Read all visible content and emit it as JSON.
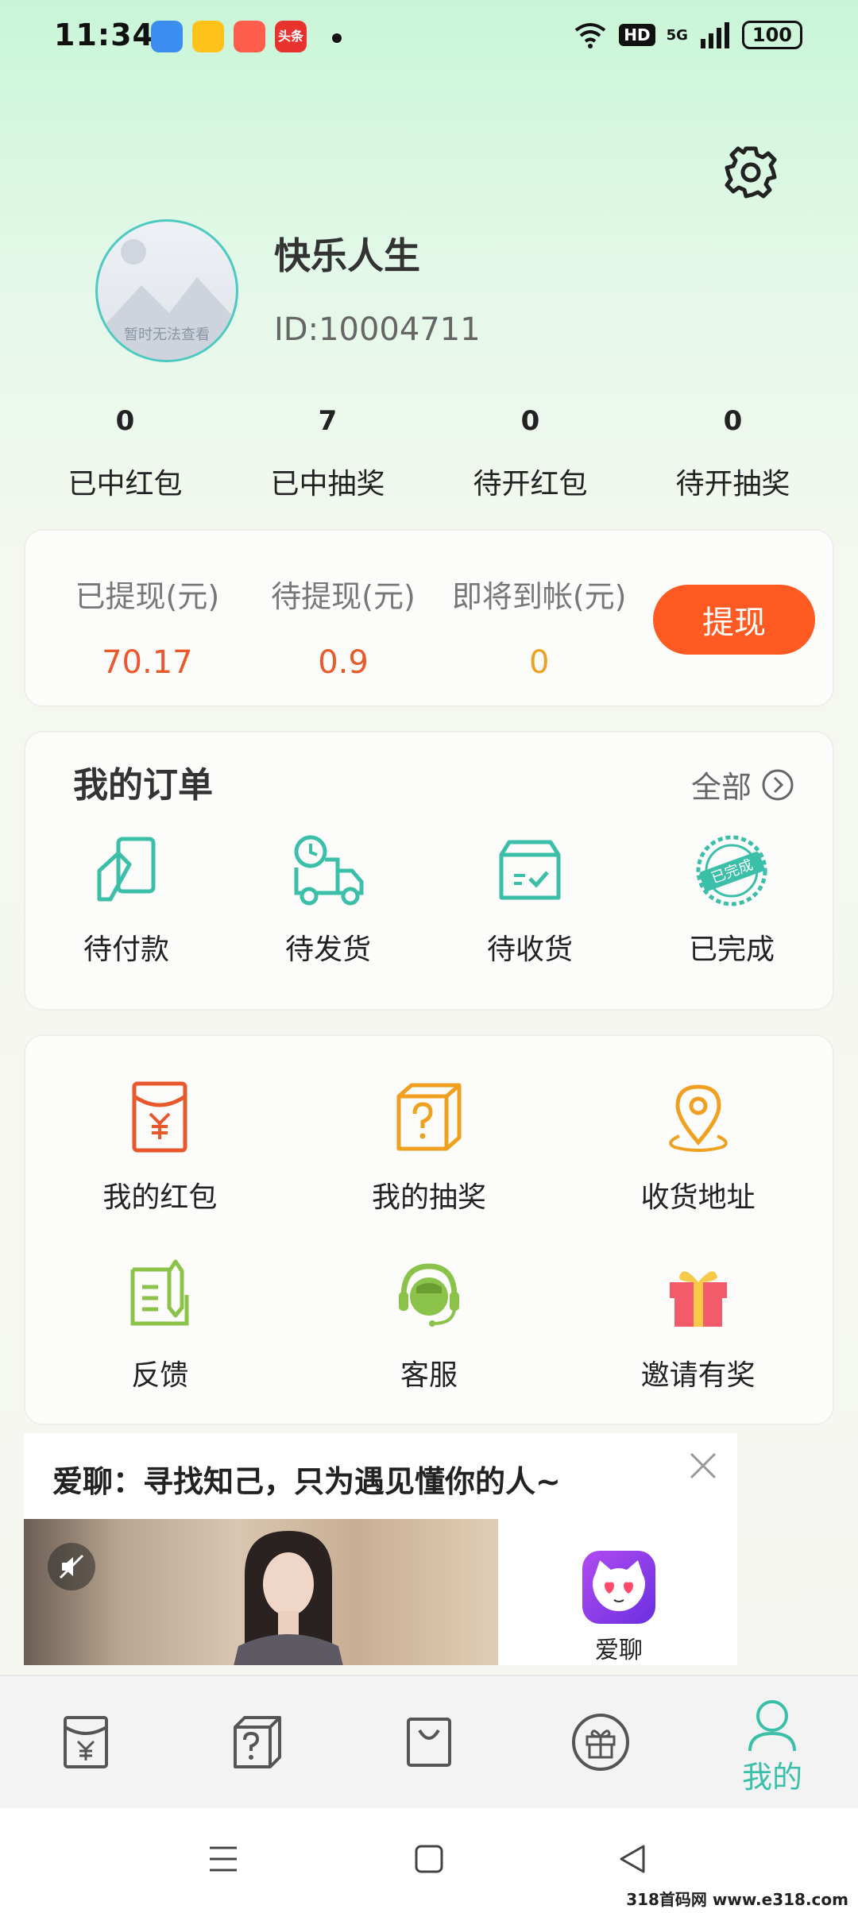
{
  "status_bar": {
    "time": "11:34",
    "notification_icons": [
      "app-icon-blue",
      "app-icon-yellow",
      "app-icon-red",
      "toutiao-icon"
    ],
    "notification_colors": [
      "#3d8cf0",
      "#ffc21a",
      "#ff5e4d",
      "#e8322e"
    ],
    "toutiao_label": "头条",
    "network_badge": "HD",
    "network_type": "5G",
    "battery": "100"
  },
  "profile": {
    "avatar_caption": "暂时无法查看",
    "name": "快乐人生",
    "id_text": "ID:10004711"
  },
  "stats": [
    {
      "value": "0",
      "label": "已中红包"
    },
    {
      "value": "7",
      "label": "已中抽奖"
    },
    {
      "value": "0",
      "label": "待开红包"
    },
    {
      "value": "0",
      "label": "待开抽奖"
    }
  ],
  "wallet": {
    "columns": [
      {
        "label": "已提现(元)",
        "value": "70.17",
        "color": "#e85a2c"
      },
      {
        "label": "待提现(元)",
        "value": "0.9",
        "color": "#e85a2c"
      },
      {
        "label": "即将到帐(元)",
        "value": "0",
        "color": "#f0a020"
      }
    ],
    "withdraw_label": "提现"
  },
  "orders": {
    "title": "我的订单",
    "all_label": "全部",
    "items": [
      {
        "label": "待付款",
        "icon": "payment-card-icon"
      },
      {
        "label": "待发货",
        "icon": "delivery-truck-icon"
      },
      {
        "label": "待收货",
        "icon": "package-box-icon"
      },
      {
        "label": "已完成",
        "icon": "completed-stamp-icon"
      }
    ],
    "stamp_text": "已完成"
  },
  "services": [
    {
      "label": "我的红包",
      "icon": "red-envelope-icon"
    },
    {
      "label": "我的抽奖",
      "icon": "mystery-box-icon"
    },
    {
      "label": "收货地址",
      "icon": "location-pin-icon"
    },
    {
      "label": "反馈",
      "icon": "feedback-note-icon"
    },
    {
      "label": "客服",
      "icon": "customer-service-icon"
    },
    {
      "label": "邀请有奖",
      "icon": "gift-box-icon"
    }
  ],
  "ad": {
    "title": "爱聊：寻找知己，只为遇见懂你的人~",
    "app_name": "爱聊"
  },
  "tabbar": {
    "tabs": [
      {
        "icon": "red-envelope-tab-icon",
        "label": ""
      },
      {
        "icon": "mystery-box-tab-icon",
        "label": ""
      },
      {
        "icon": "shopping-bag-tab-icon",
        "label": ""
      },
      {
        "icon": "gift-tab-icon",
        "label": ""
      },
      {
        "icon": "profile-tab-icon",
        "label": "我的"
      }
    ],
    "active_color": "#3cbfa8",
    "inactive_color": "#555555"
  },
  "watermark": "318首码网 www.e318.com",
  "colors": {
    "accent_teal": "#3cbfa8",
    "withdraw_orange": "#ff5a22",
    "icon_red": "#e8582c",
    "icon_orange": "#f0a020",
    "icon_green": "#8bc34a"
  }
}
